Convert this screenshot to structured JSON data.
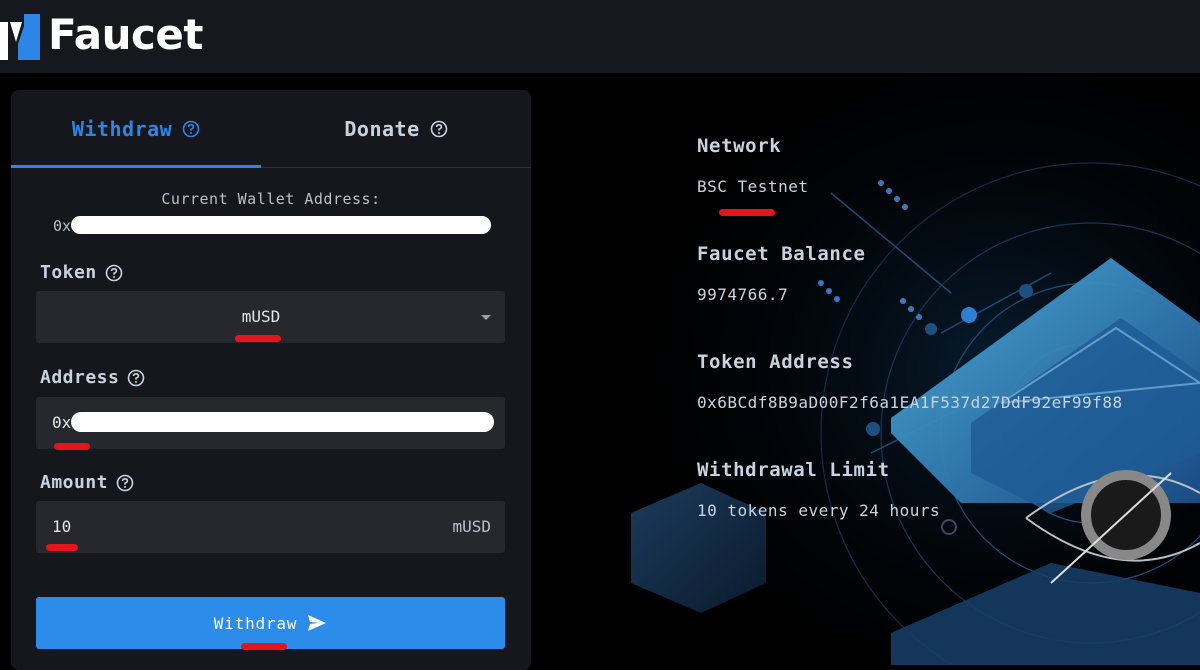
{
  "app": {
    "brand": "Faucet"
  },
  "tabs": [
    {
      "label": "Withdraw",
      "active": true
    },
    {
      "label": "Donate",
      "active": false
    }
  ],
  "wallet": {
    "label": "Current Wallet Address:",
    "value_prefix": "0x"
  },
  "token": {
    "label": "Token",
    "selected": "mUSD"
  },
  "address": {
    "label": "Address",
    "value_prefix": "0x"
  },
  "amount": {
    "label": "Amount",
    "value": "10",
    "unit": "mUSD"
  },
  "withdraw_button": {
    "label": "Withdraw"
  },
  "info": {
    "network_title": "Network",
    "network_value": "BSC Testnet",
    "balance_title": "Faucet Balance",
    "balance_value": "9974766.7",
    "token_address_title": "Token Address",
    "token_address_value": "0x6BCdf8B9aD00F2f6a1EA1F537d27DdF92eF99f88",
    "limit_title": "Withdrawal Limit",
    "limit_value": "10 tokens every 24 hours"
  },
  "colors": {
    "accent": "#2d86e6",
    "header_bg": "#16181d",
    "card_bg": "#15171d",
    "input_bg": "#26282e",
    "button_bg": "#2b8ce9",
    "annotation_red": "#e4161b"
  },
  "icons": {
    "help": "question-circle-icon",
    "send": "paper-plane-icon",
    "caret": "caret-down-icon"
  }
}
